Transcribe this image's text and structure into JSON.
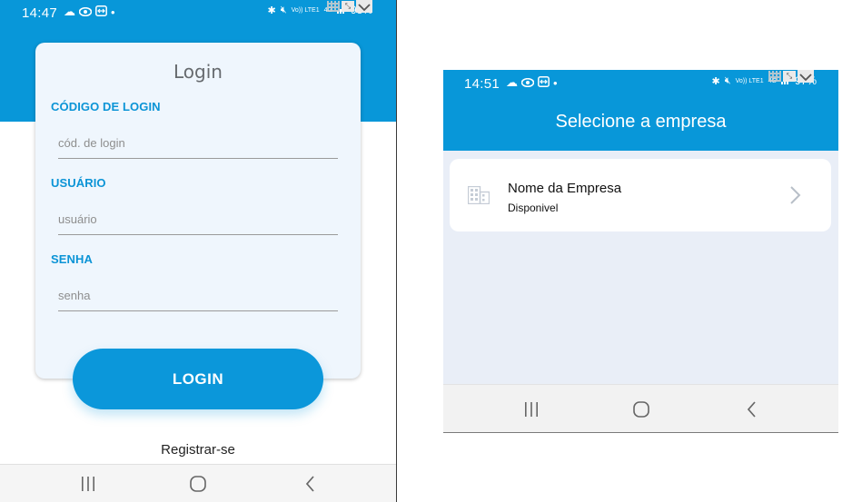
{
  "login_screen": {
    "status": {
      "time": "14:47",
      "battery": "98%",
      "network": "4G",
      "volte": "Vo)) LTE1"
    },
    "title": "Login",
    "fields": [
      {
        "label": "CÓDIGO DE LOGIN",
        "placeholder": "cód. de login"
      },
      {
        "label": "USUÁRIO",
        "placeholder": "usuário"
      },
      {
        "label": "SENHA",
        "placeholder": "senha"
      }
    ],
    "login_button": "LOGIN",
    "register_link": "Registrar-se"
  },
  "company_screen": {
    "status": {
      "time": "14:51",
      "battery": "97%",
      "network": "4G",
      "volte": "Vo)) LTE1"
    },
    "title": "Selecione a empresa",
    "companies": [
      {
        "name": "Nome da Empresa",
        "status": "Disponivel"
      }
    ]
  },
  "colors": {
    "primary": "#0897d9",
    "card_bg": "#eff6fd",
    "list_bg": "#e9eef7"
  },
  "icons": [
    "cloud-icon",
    "eye-icon",
    "teamviewer-icon",
    "bluetooth-icon",
    "mute-icon",
    "signal-icon",
    "battery-icon",
    "building-icon",
    "chevron-right-icon",
    "recents-icon",
    "home-icon",
    "back-icon"
  ]
}
